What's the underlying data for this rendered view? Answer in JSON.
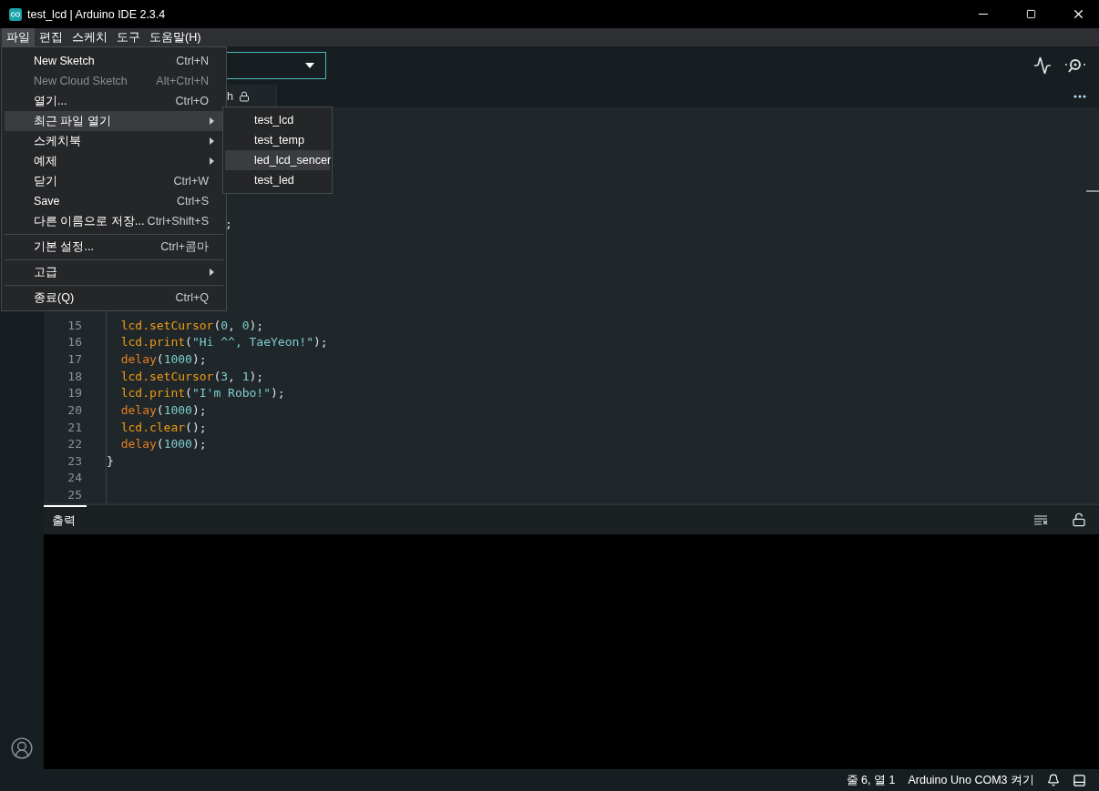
{
  "window": {
    "title": "test_lcd | Arduino IDE 2.3.4"
  },
  "menubar": [
    {
      "label": "파일",
      "selected": true
    },
    {
      "label": "편집",
      "selected": false
    },
    {
      "label": "스케치",
      "selected": false
    },
    {
      "label": "도구",
      "selected": false
    },
    {
      "label": "도움말(H)",
      "selected": false
    }
  ],
  "file_menu": [
    {
      "kind": "item",
      "label": "New Sketch",
      "shortcut": "Ctrl+N",
      "disabled": false,
      "selected": false
    },
    {
      "kind": "item",
      "label": "New Cloud Sketch",
      "shortcut": "Alt+Ctrl+N",
      "disabled": true,
      "selected": false
    },
    {
      "kind": "item",
      "label": "열기...",
      "shortcut": "Ctrl+O",
      "disabled": false,
      "selected": false
    },
    {
      "kind": "submenu",
      "label": "최근 파일 열기",
      "disabled": false,
      "selected": true
    },
    {
      "kind": "submenu",
      "label": "스케치북",
      "disabled": false,
      "selected": false
    },
    {
      "kind": "submenu",
      "label": "예제",
      "disabled": false,
      "selected": false
    },
    {
      "kind": "item",
      "label": "닫기",
      "shortcut": "Ctrl+W",
      "disabled": false,
      "selected": false
    },
    {
      "kind": "item",
      "label": "Save",
      "shortcut": "Ctrl+S",
      "disabled": false,
      "selected": false
    },
    {
      "kind": "item",
      "label": "다른 이름으로 저장...",
      "shortcut": "Ctrl+Shift+S",
      "disabled": false,
      "selected": false
    },
    {
      "kind": "separator"
    },
    {
      "kind": "item",
      "label": "기본 설정...",
      "shortcut": "Ctrl+콤마",
      "disabled": false,
      "selected": false
    },
    {
      "kind": "separator"
    },
    {
      "kind": "submenu",
      "label": "고급",
      "disabled": false,
      "selected": false
    },
    {
      "kind": "separator"
    },
    {
      "kind": "item",
      "label": "종료(Q)",
      "shortcut": "Ctrl+Q",
      "disabled": false,
      "selected": false
    }
  ],
  "recent_files": [
    {
      "label": "test_lcd",
      "selected": false
    },
    {
      "label": "test_temp",
      "selected": false
    },
    {
      "label": "led_lcd_sencer",
      "selected": true
    },
    {
      "label": "test_led",
      "selected": false
    }
  ],
  "editor_tab": {
    "label": "h"
  },
  "editor": {
    "covered_fragment": {
      "tokens": [
        {
          "kind": "punct",
          "text": ";"
        }
      ]
    },
    "lines": [
      {
        "number": "15",
        "tokens": [
          {
            "kind": "fn",
            "text": "  lcd.setCursor"
          },
          {
            "kind": "punct",
            "text": "("
          },
          {
            "kind": "num",
            "text": "0"
          },
          {
            "kind": "punct",
            "text": ", "
          },
          {
            "kind": "num",
            "text": "0"
          },
          {
            "kind": "punct",
            "text": ");"
          }
        ]
      },
      {
        "number": "16",
        "tokens": [
          {
            "kind": "fn",
            "text": "  lcd.print"
          },
          {
            "kind": "punct",
            "text": "("
          },
          {
            "kind": "str",
            "text": "\"Hi ^^, TaeYeon!\""
          },
          {
            "kind": "punct",
            "text": ");"
          }
        ]
      },
      {
        "number": "17",
        "tokens": [
          {
            "kind": "key",
            "text": "  delay"
          },
          {
            "kind": "punct",
            "text": "("
          },
          {
            "kind": "num",
            "text": "1000"
          },
          {
            "kind": "punct",
            "text": ");"
          }
        ]
      },
      {
        "number": "18",
        "tokens": [
          {
            "kind": "fn",
            "text": "  lcd.setCursor"
          },
          {
            "kind": "punct",
            "text": "("
          },
          {
            "kind": "num",
            "text": "3"
          },
          {
            "kind": "punct",
            "text": ", "
          },
          {
            "kind": "num",
            "text": "1"
          },
          {
            "kind": "punct",
            "text": ");"
          }
        ]
      },
      {
        "number": "19",
        "tokens": [
          {
            "kind": "fn",
            "text": "  lcd.print"
          },
          {
            "kind": "punct",
            "text": "("
          },
          {
            "kind": "str",
            "text": "\"I'm Robo!\""
          },
          {
            "kind": "punct",
            "text": ");"
          }
        ]
      },
      {
        "number": "20",
        "tokens": [
          {
            "kind": "key",
            "text": "  delay"
          },
          {
            "kind": "punct",
            "text": "("
          },
          {
            "kind": "num",
            "text": "1000"
          },
          {
            "kind": "punct",
            "text": ");"
          }
        ]
      },
      {
        "number": "21",
        "tokens": [
          {
            "kind": "fn",
            "text": "  lcd.clear"
          },
          {
            "kind": "punct",
            "text": "();"
          }
        ]
      },
      {
        "number": "22",
        "tokens": [
          {
            "kind": "key",
            "text": "  delay"
          },
          {
            "kind": "punct",
            "text": "("
          },
          {
            "kind": "num",
            "text": "1000"
          },
          {
            "kind": "punct",
            "text": ");"
          }
        ]
      },
      {
        "number": "23",
        "tokens": [
          {
            "kind": "punct",
            "text": "}"
          }
        ]
      },
      {
        "number": "24"
      },
      {
        "number": "25"
      }
    ]
  },
  "output": {
    "tab": "출력"
  },
  "status_bar": {
    "position": "줄 6, 열 1",
    "board": "Arduino Uno COM3 켜기"
  }
}
